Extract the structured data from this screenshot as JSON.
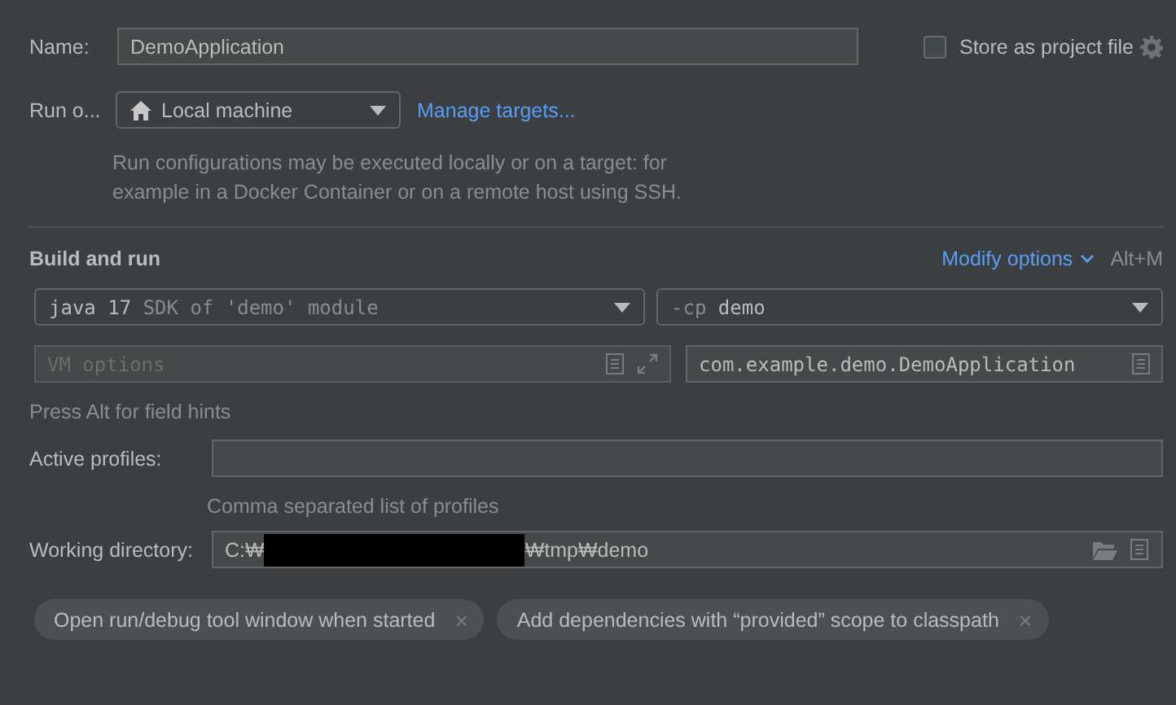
{
  "name_field": {
    "label": "Name:",
    "value": "DemoApplication"
  },
  "store_as_project_file": {
    "label": "Store as project file",
    "checked": false
  },
  "run_on": {
    "label": "Run o...",
    "value": "Local machine",
    "link": "Manage targets...",
    "help_lines": [
      "Run configurations may be executed locally or on a target: for",
      "example in a Docker Container or on a remote host using SSH."
    ]
  },
  "build_and_run": {
    "title": "Build and run",
    "modify_options": "Modify options",
    "shortcut": "Alt+M",
    "jdk": {
      "value": "java 17",
      "hint": "SDK of 'demo' module"
    },
    "classpath": {
      "prefix": "-cp",
      "value": "demo"
    },
    "vm_options": {
      "placeholder": "VM options"
    },
    "main_class": {
      "value": "com.example.demo.DemoApplication"
    },
    "hint": "Press Alt for field hints"
  },
  "active_profiles": {
    "label": "Active profiles:",
    "help": "Comma separated list of profiles"
  },
  "working_directory": {
    "label": "Working directory:",
    "prefix": "C:₩",
    "redacted": true,
    "suffix": "₩tmp₩demo"
  },
  "chips": [
    {
      "label": "Open run/debug tool window when started",
      "close": "×"
    },
    {
      "label": "Add dependencies with “provided” scope to classpath",
      "close": "×"
    }
  ]
}
